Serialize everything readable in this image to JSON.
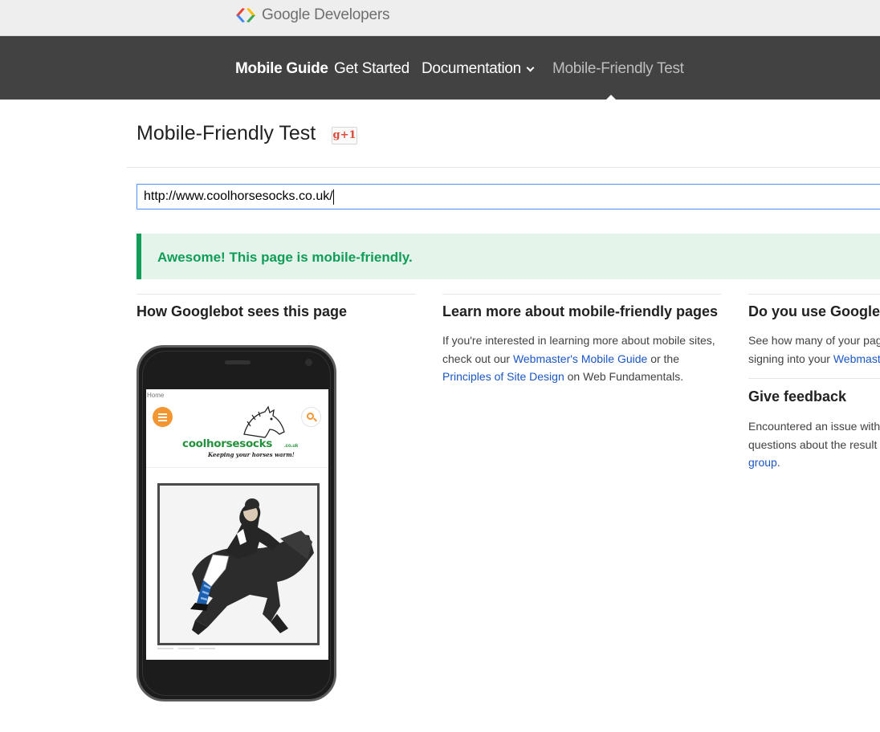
{
  "brand": {
    "name_prefix": "Google",
    "name_suffix": "Developers",
    "logo_icon": "google-developers-logo-icon"
  },
  "nav": {
    "items": [
      {
        "label": "Mobile Guide",
        "state": "active"
      },
      {
        "label": "Get Started",
        "state": "normal"
      },
      {
        "label": "Documentation",
        "state": "dropdown"
      },
      {
        "label": "Mobile-Friendly Test",
        "state": "current"
      }
    ]
  },
  "page": {
    "title": "Mobile-Friendly Test",
    "gplus_label": "g+1"
  },
  "url_input": {
    "value": "http://www.coolhorsesocks.co.uk/"
  },
  "result": {
    "message": "Awesome! This page is mobile-friendly.",
    "status_color": "#0f9d58"
  },
  "columns": {
    "googlebot": {
      "heading": "How Googlebot sees this page"
    },
    "learn_more": {
      "heading": "Learn more about mobile-friendly pages",
      "text_1": "If you're interested in learning more about mobile sites, check out our ",
      "link_1": "Webmaster's Mobile Guide",
      "text_2": " or the ",
      "link_2": "Principles of Site Design",
      "text_3": " on Web Fundamentals."
    },
    "webmaster": {
      "heading": "Do you use Google",
      "text_1": "See how many of your pag",
      "text_2": "signing into your ",
      "link_1": "Webmast"
    },
    "feedback": {
      "heading": "Give feedback",
      "text_1": "Encountered an issue with",
      "text_2": "questions about the result",
      "link_1": "group",
      "text_3": "."
    }
  },
  "phone_preview": {
    "home_label": "Home",
    "site_name": "coolhorsesocks",
    "site_tld": ".co.uk",
    "tagline": "Keeping your horses warm!",
    "menu_icon": "hamburger-menu-icon",
    "search_icon": "search-icon",
    "accent_color": "#f39530",
    "brand_color": "#23913b"
  }
}
